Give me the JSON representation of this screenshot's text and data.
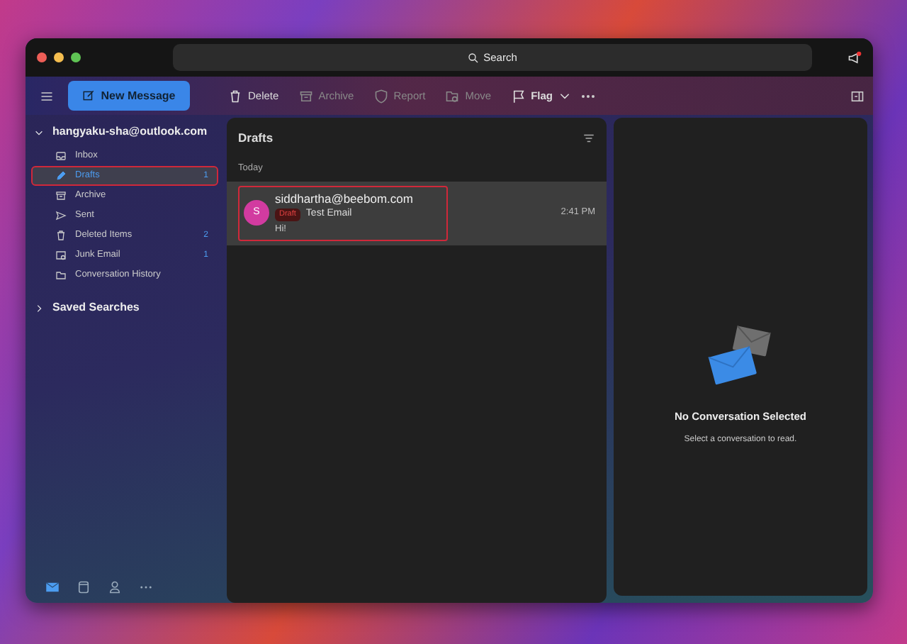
{
  "title_bar": {
    "search_placeholder": "Search"
  },
  "toolbar": {
    "new_message": "New Message",
    "actions": [
      {
        "label": "Delete",
        "disabled": false
      },
      {
        "label": "Archive",
        "disabled": true
      },
      {
        "label": "Report",
        "disabled": true
      },
      {
        "label": "Move",
        "disabled": true
      },
      {
        "label": "Flag",
        "disabled": false
      }
    ]
  },
  "sidebar": {
    "account": {
      "label": "hangyaku-sha@outlook.com",
      "expanded": true,
      "children": [
        {
          "label": "Inbox",
          "selected": false,
          "annotated": false
        },
        {
          "label": "Drafts",
          "count": "1",
          "selected": true,
          "annotated": true
        },
        {
          "label": "Archive",
          "selected": false,
          "annotated": false
        },
        {
          "label": "Sent",
          "selected": false,
          "annotated": false
        },
        {
          "label": "Deleted Items",
          "count": "2",
          "selected": false,
          "annotated": false
        },
        {
          "label": "Junk Email",
          "count": "1",
          "selected": false,
          "annotated": false
        },
        {
          "label": "Conversation History",
          "selected": false,
          "annotated": false
        }
      ]
    },
    "saved_searches": {
      "label": "Saved Searches",
      "expanded": false
    },
    "bottom_nav": [
      {
        "selected": true
      },
      {
        "selected": false
      },
      {
        "selected": false
      },
      {
        "selected": false
      }
    ]
  },
  "message_list": {
    "title": "Drafts",
    "group": "Today",
    "messages": [
      {
        "avatar": "S",
        "sender": "siddhartha@beebom.com",
        "tag": "Draft",
        "subject": "Test Email",
        "preview": "Hi!",
        "time": "2:41 PM",
        "selected": true,
        "annotated": true
      }
    ]
  },
  "reading_pane": {
    "title": "No Conversation Selected",
    "subtitle": "Select a conversation to read."
  }
}
